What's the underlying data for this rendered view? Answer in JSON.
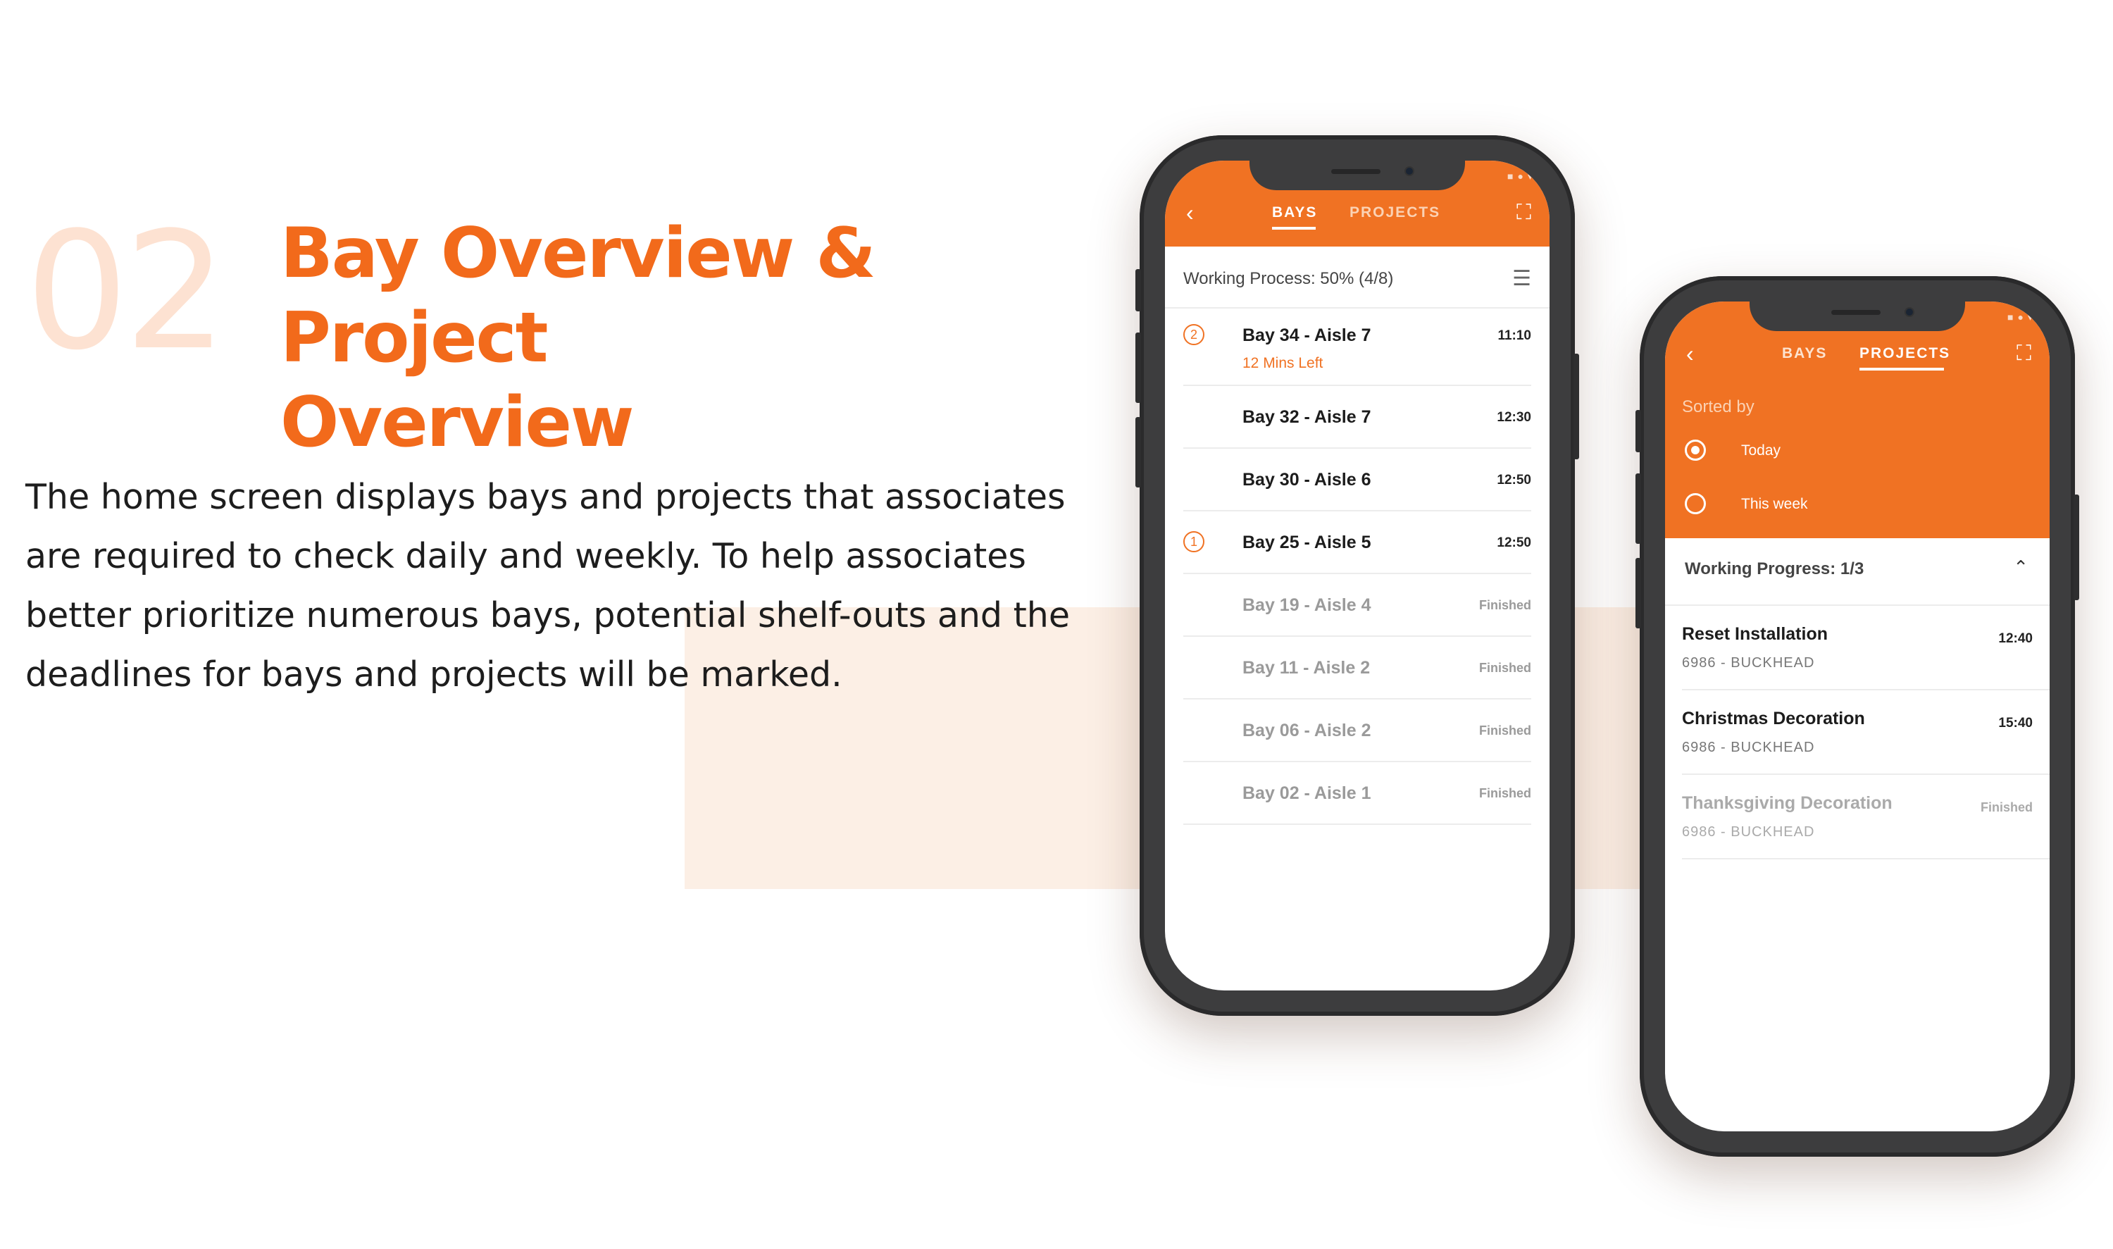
{
  "section_number": "02",
  "headline": {
    "line1": "Bay Overview &",
    "line2": "Project Overview"
  },
  "description": [
    "The home screen displays bays and projects that associates",
    "are required to check daily and weekly. To help associates",
    "better prioritize numerous bays, potential shelf-outs and the",
    "deadlines for bays and projects will be marked."
  ],
  "colors": {
    "accent": "#f07223",
    "band": "#fcefe5",
    "number": "#fde2d2",
    "phone_body": "#3d3d3e"
  },
  "phone_bays": {
    "icons": {
      "back": "chevron-left-icon",
      "expand": "fullscreen-icon",
      "filter": "sliders-icon"
    },
    "tabs": [
      {
        "label": "BAYS",
        "active": true
      },
      {
        "label": "PROJECTS",
        "active": false
      }
    ],
    "progress_label": "Working Process: 50% (4/8)",
    "rows": [
      {
        "priority": "2",
        "name": "Bay 34 - Aisle 7",
        "time": "11:10",
        "note": "12 Mins Left",
        "finished": false
      },
      {
        "priority": "",
        "name": "Bay 32 - Aisle 7",
        "time": "12:30",
        "note": "",
        "finished": false
      },
      {
        "priority": "",
        "name": "Bay 30 - Aisle 6",
        "time": "12:50",
        "note": "",
        "finished": false
      },
      {
        "priority": "1",
        "name": "Bay 25 - Aisle 5",
        "time": "12:50",
        "note": "",
        "finished": false
      },
      {
        "priority": "",
        "name": "Bay 19 - Aisle 4",
        "time": "Finished",
        "note": "",
        "finished": true
      },
      {
        "priority": "",
        "name": "Bay 11 - Aisle 2",
        "time": "Finished",
        "note": "",
        "finished": true
      },
      {
        "priority": "",
        "name": "Bay 06 - Aisle 2",
        "time": "Finished",
        "note": "",
        "finished": true
      },
      {
        "priority": "",
        "name": "Bay 02 - Aisle 1",
        "time": "Finished",
        "note": "",
        "finished": true
      }
    ]
  },
  "phone_projects": {
    "tabs": [
      {
        "label": "BAYS",
        "active": false
      },
      {
        "label": "PROJECTS",
        "active": true
      }
    ],
    "sorted_by_label": "Sorted by",
    "sort_options": [
      {
        "label": "Today",
        "selected": true
      },
      {
        "label": "This week",
        "selected": false
      }
    ],
    "progress_label": "Working Progress: 1/3",
    "projects": [
      {
        "name": "Reset Installation",
        "store": "6986 - BUCKHEAD",
        "time": "12:40",
        "finished": false
      },
      {
        "name": "Christmas Decoration",
        "store": "6986 - BUCKHEAD",
        "time": "15:40",
        "finished": false
      },
      {
        "name": "Thanksgiving Decoration",
        "store": "6986 - BUCKHEAD",
        "time": "Finished",
        "finished": true
      }
    ]
  }
}
